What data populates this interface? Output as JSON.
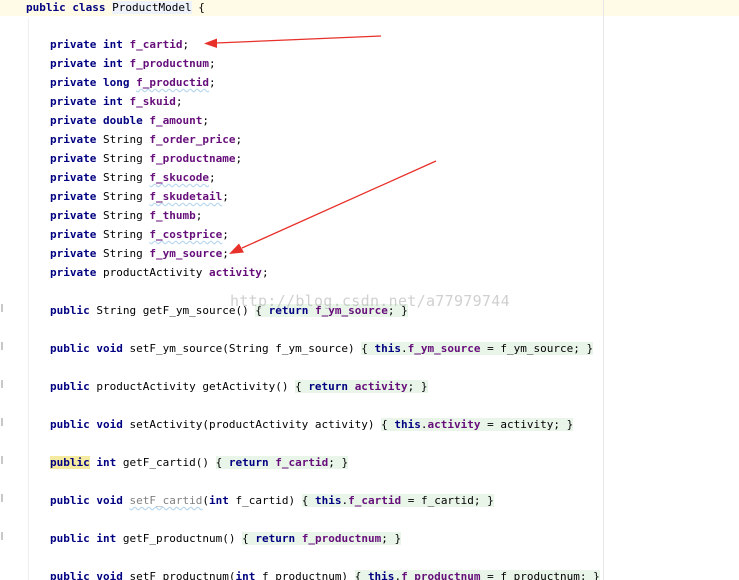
{
  "editor": {
    "class_decl": {
      "public": "public",
      "class": "class",
      "name": "ProductModel",
      "brace": " {"
    },
    "fields": [
      {
        "mod": "private",
        "type": "int",
        "name": "f_cartid",
        "type_kw": true
      },
      {
        "mod": "private",
        "type": "int",
        "name": "f_productnum",
        "type_kw": true
      },
      {
        "mod": "private",
        "type": "long",
        "name": "f_productid",
        "type_kw": true
      },
      {
        "mod": "private",
        "type": "int",
        "name": "f_skuid",
        "type_kw": true
      },
      {
        "mod": "private",
        "type": "double",
        "name": "f_amount",
        "type_kw": true
      },
      {
        "mod": "private",
        "type": "String",
        "name": "f_order_price",
        "type_kw": false
      },
      {
        "mod": "private",
        "type": "String",
        "name": "f_productname",
        "type_kw": false
      },
      {
        "mod": "private",
        "type": "String",
        "name": "f_skucode",
        "type_kw": false
      },
      {
        "mod": "private",
        "type": "String",
        "name": "f_skudetail",
        "type_kw": false
      },
      {
        "mod": "private",
        "type": "String",
        "name": "f_thumb",
        "type_kw": false
      },
      {
        "mod": "private",
        "type": "String",
        "name": "f_costprice",
        "type_kw": false
      },
      {
        "mod": "private",
        "type": "String",
        "name": "f_ym_source",
        "type_kw": false
      },
      {
        "mod": "private",
        "type": "productActivity",
        "name": "activity",
        "type_kw": false
      }
    ],
    "methods": [
      {
        "public": "public",
        "ret": "String",
        "sig": "getF_ym_source()",
        "body_kw": "return",
        "body_field": "f_ym_source"
      },
      {
        "public": "public",
        "ret": "void",
        "sig": "setF_ym_source(String f_ym_source)",
        "this": "this",
        "field": "f_ym_source",
        "assign": " = f_ym_source;"
      },
      {
        "public": "public",
        "ret": "productActivity",
        "sig": "getActivity()",
        "body_kw": "return",
        "body_field": "activity"
      },
      {
        "public": "public",
        "ret": "void",
        "sig": "setActivity(productActivity activity)",
        "this": "this",
        "field": "activity",
        "assign": " = activity;"
      },
      {
        "public": "public",
        "ret": "int",
        "sig": "getF_cartid()",
        "body_kw": "return",
        "body_field": "f_cartid"
      },
      {
        "public": "public",
        "ret": "void",
        "sig_name": "setF_cartid",
        "param_kw": "int",
        "param_rest": " f_cartid)",
        "this": "this",
        "field": "f_cartid",
        "assign": " = f_cartid;"
      },
      {
        "public": "public",
        "ret": "int",
        "sig": "getF_productnum()",
        "body_kw": "return",
        "body_field": "f_productnum"
      },
      {
        "public": "public",
        "ret": "void",
        "sig": "setF_productnum(",
        "param_kw": "int",
        "param_rest": " f_productnum)",
        "this": "this",
        "field": "f_productnum",
        "assign": " = f_productnum;"
      }
    ],
    "punct": {
      "semicolon": ";",
      "open_brace": "{ ",
      "close_brace": " }",
      "dot": "."
    }
  },
  "watermark": "http://blog.csdn.net/a77979744",
  "colors": {
    "keyword": "#000080",
    "field": "#660e7a",
    "annotation_arrow": "#e8302a",
    "class_line_bg": "#fffbe6",
    "fold_bg": "#eaf5ea"
  }
}
